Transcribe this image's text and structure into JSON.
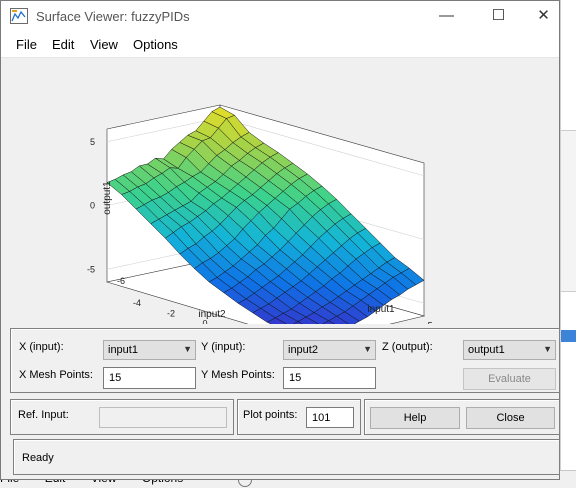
{
  "window": {
    "title": "Surface Viewer: fuzzyPIDs"
  },
  "menu": [
    "File",
    "Edit",
    "View",
    "Options"
  ],
  "background": {
    "menu": [
      "File",
      "Edit",
      "View",
      "Options"
    ]
  },
  "controls": {
    "x_label": "X (input):",
    "x_value": "input1",
    "y_label": "Y (input):",
    "y_value": "input2",
    "z_label": "Z (output):",
    "z_value": "output1",
    "x_mesh_label": "X Mesh Points:",
    "x_mesh_value": "15",
    "y_mesh_label": "Y Mesh Points:",
    "y_mesh_value": "15",
    "evaluate_label": "Evaluate",
    "ref_input_label": "Ref. Input:",
    "ref_input_value": "",
    "plot_points_label": "Plot points:",
    "plot_points_value": "101",
    "help_label": "Help",
    "close_label": "Close"
  },
  "status": "Ready",
  "chart_data": {
    "type": "surface",
    "xlabel": "input2",
    "ylabel": "input1",
    "zlabel": "output1",
    "x_ticks": [
      "-4",
      "-2",
      "0",
      "2",
      "4",
      "6"
    ],
    "y_ticks": [
      "-5",
      "0",
      "5"
    ],
    "z_ticks": [
      "5",
      "0",
      "-5",
      "-6"
    ],
    "xlim": [
      -6,
      6
    ],
    "ylim": [
      -6,
      6
    ],
    "zlim": [
      -6,
      6
    ],
    "grid": true,
    "colormap": [
      "#3c2ac8",
      "#0f72e6",
      "#13b4d8",
      "#3cd28c",
      "#a2d24a",
      "#f2e020"
    ],
    "x": [
      -6,
      -5.14,
      -4.29,
      -3.43,
      -2.57,
      -1.71,
      -0.86,
      0,
      0.86,
      1.71,
      2.57,
      3.43,
      4.29,
      5.14,
      6
    ],
    "y": [
      -6,
      -5.14,
      -4.29,
      -3.43,
      -2.57,
      -1.71,
      -0.86,
      0,
      0.86,
      1.71,
      2.57,
      3.43,
      4.29,
      5.14,
      6
    ],
    "z_rows": [
      [
        1.8,
        1.9,
        2.1,
        2.2,
        2.5,
        2.5,
        2.8,
        2.6,
        3.2,
        3.6,
        4.0,
        4.2,
        4.8,
        5.4,
        5.6
      ],
      [
        1.2,
        1.3,
        1.5,
        1.6,
        1.9,
        2.1,
        2.4,
        2.2,
        2.9,
        3.4,
        3.9,
        4.0,
        4.6,
        5.2,
        5.3
      ],
      [
        0.4,
        0.6,
        0.8,
        0.9,
        1.1,
        1.4,
        1.6,
        1.9,
        2.1,
        2.6,
        3.1,
        3.4,
        3.8,
        4.1,
        4.3
      ],
      [
        -0.4,
        -0.2,
        0.0,
        0.2,
        0.4,
        0.6,
        1.1,
        1.4,
        1.7,
        2.1,
        2.6,
        2.9,
        3.3,
        3.6,
        3.8
      ],
      [
        -1.2,
        -0.9,
        -0.6,
        -0.4,
        -0.1,
        0.2,
        0.6,
        0.9,
        1.3,
        1.7,
        2.1,
        2.5,
        2.9,
        3.2,
        3.4
      ],
      [
        -2.1,
        -1.8,
        -1.6,
        -1.2,
        -0.9,
        -0.5,
        0.0,
        0.5,
        0.9,
        1.2,
        1.6,
        2.0,
        2.4,
        2.7,
        2.9
      ],
      [
        -2.9,
        -2.6,
        -2.4,
        -2.1,
        -1.7,
        -1.3,
        -0.7,
        -0.2,
        0.3,
        0.7,
        1.1,
        1.5,
        1.9,
        2.2,
        2.4
      ],
      [
        -3.6,
        -3.4,
        -3.1,
        -2.8,
        -2.4,
        -2.0,
        -1.6,
        -1.0,
        -0.6,
        0.0,
        0.6,
        0.9,
        1.3,
        1.6,
        1.8
      ],
      [
        -4.1,
        -3.9,
        -3.6,
        -3.3,
        -2.9,
        -2.6,
        -2.2,
        -1.8,
        -1.3,
        -0.8,
        -0.3,
        0.2,
        0.6,
        0.9,
        1.1
      ],
      [
        -4.6,
        -4.4,
        -4.1,
        -3.8,
        -3.5,
        -3.2,
        -2.8,
        -2.4,
        -2.0,
        -1.5,
        -1.0,
        -0.6,
        -0.2,
        0.1,
        0.3
      ],
      [
        -5.0,
        -4.8,
        -4.6,
        -4.3,
        -4.0,
        -3.7,
        -3.4,
        -3.0,
        -2.6,
        -2.2,
        -1.8,
        -1.4,
        -1.0,
        -0.7,
        -0.5
      ],
      [
        -5.4,
        -5.2,
        -5.0,
        -4.8,
        -4.5,
        -4.2,
        -3.9,
        -3.6,
        -3.2,
        -2.9,
        -2.5,
        -2.1,
        -1.8,
        -1.5,
        -1.3
      ],
      [
        -5.6,
        -5.5,
        -5.3,
        -5.1,
        -4.9,
        -4.6,
        -4.4,
        -4.1,
        -3.8,
        -3.5,
        -3.2,
        -2.9,
        -2.6,
        -2.3,
        -2.1
      ],
      [
        -5.8,
        -5.7,
        -5.6,
        -5.4,
        -5.2,
        -5.0,
        -4.8,
        -4.5,
        -4.2,
        -3.9,
        -3.6,
        -3.3,
        -3.0,
        -2.8,
        -2.6
      ],
      [
        -5.9,
        -5.9,
        -5.8,
        -5.7,
        -5.5,
        -5.4,
        -5.2,
        -5.0,
        -4.7,
        -4.4,
        -4.1,
        -3.9,
        -3.6,
        -3.4,
        -3.2
      ]
    ]
  }
}
